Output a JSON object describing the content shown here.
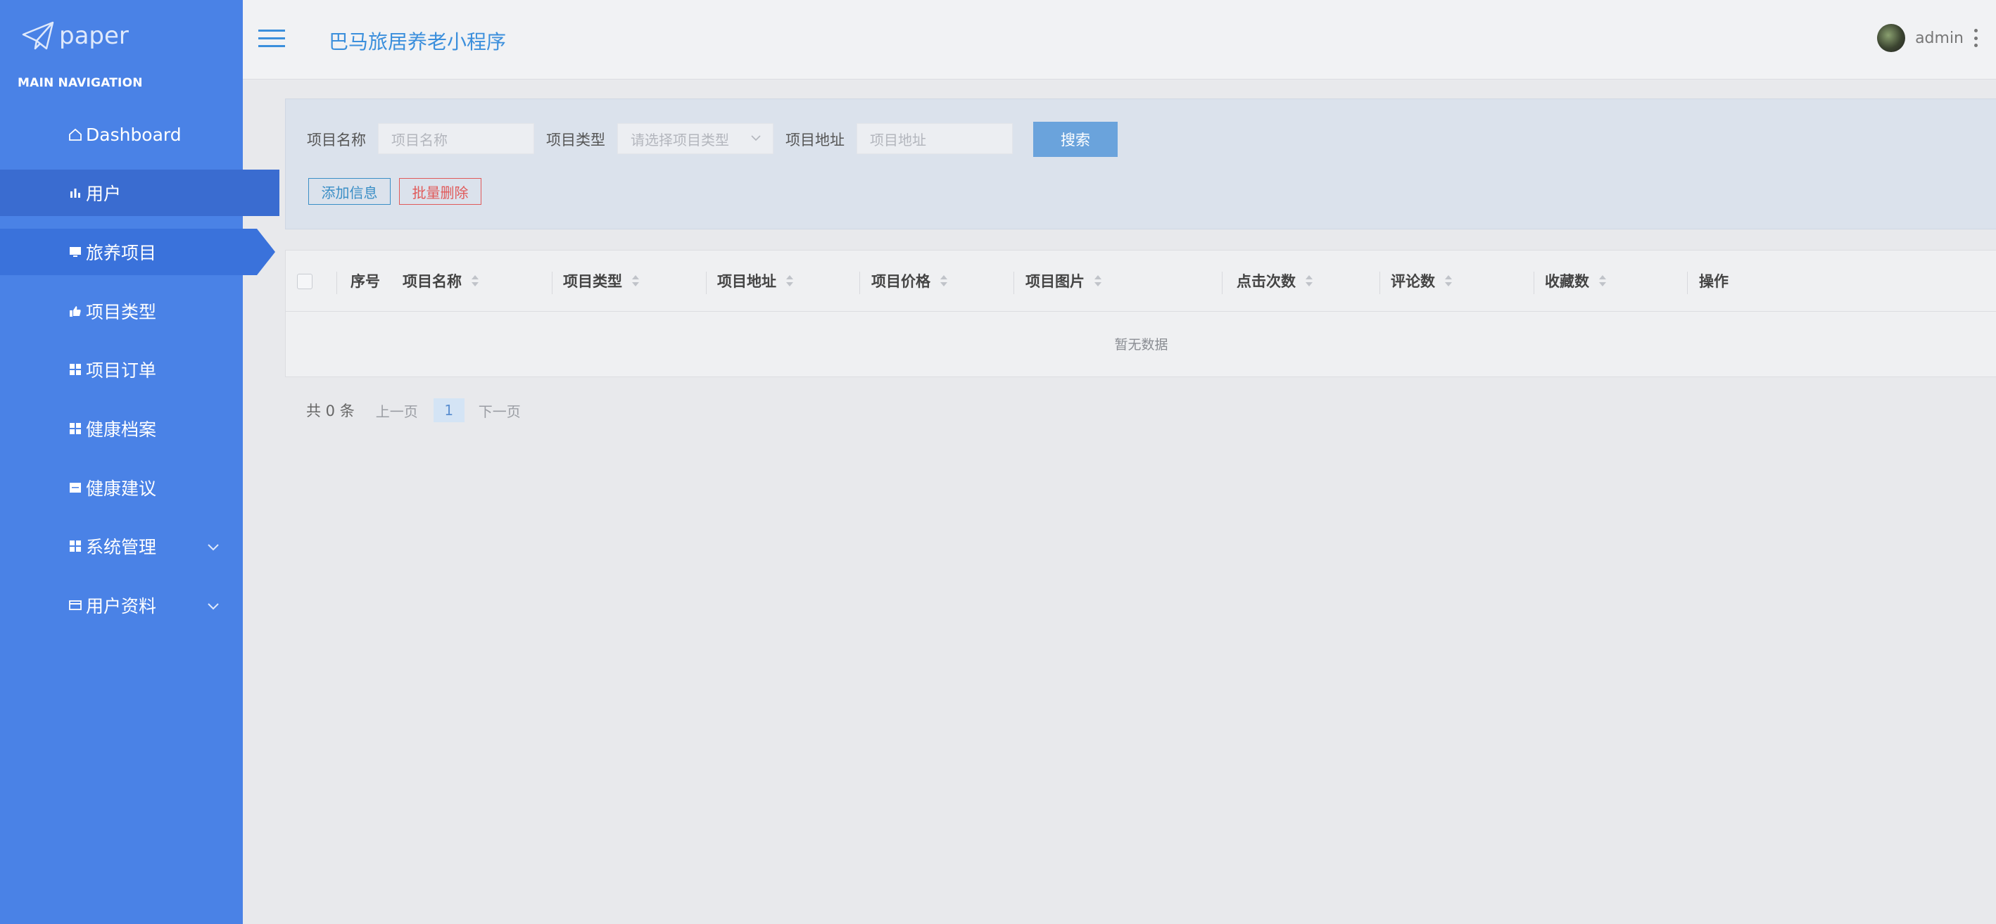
{
  "sidebar": {
    "logo_text": "paper",
    "section_title": "MAIN NAVIGATION",
    "items": [
      {
        "label": "Dashboard",
        "icon": "home-icon"
      },
      {
        "label": "用户",
        "icon": "bar-chart-icon"
      },
      {
        "label": "旅养项目",
        "icon": "monitor-icon"
      },
      {
        "label": "项目类型",
        "icon": "thumbs-up-icon"
      },
      {
        "label": "项目订单",
        "icon": "grid-icon"
      },
      {
        "label": "健康档案",
        "icon": "grid-icon"
      },
      {
        "label": "健康建议",
        "icon": "note-icon"
      },
      {
        "label": "系统管理",
        "icon": "grid-icon"
      },
      {
        "label": "用户资料",
        "icon": "card-icon"
      }
    ]
  },
  "header": {
    "app_title": "巴马旅居养老小程序",
    "username": "admin"
  },
  "search": {
    "name_label": "项目名称",
    "name_placeholder": "项目名称",
    "type_label": "项目类型",
    "type_placeholder": "请选择项目类型",
    "address_label": "项目地址",
    "address_placeholder": "项目地址",
    "search_button": "搜索",
    "add_button": "添加信息",
    "batch_delete_button": "批量删除"
  },
  "table": {
    "columns": [
      "序号",
      "项目名称",
      "项目类型",
      "项目地址",
      "项目价格",
      "项目图片",
      "点击次数",
      "评论数",
      "收藏数",
      "操作"
    ],
    "empty_text": "暂无数据"
  },
  "pagination": {
    "total_text": "共 0 条",
    "prev": "上一页",
    "current_page": "1",
    "next": "下一页"
  },
  "colors": {
    "sidebar_bg": "#4a82e6",
    "accent": "#3b8fdc",
    "danger": "#e05a5a"
  }
}
